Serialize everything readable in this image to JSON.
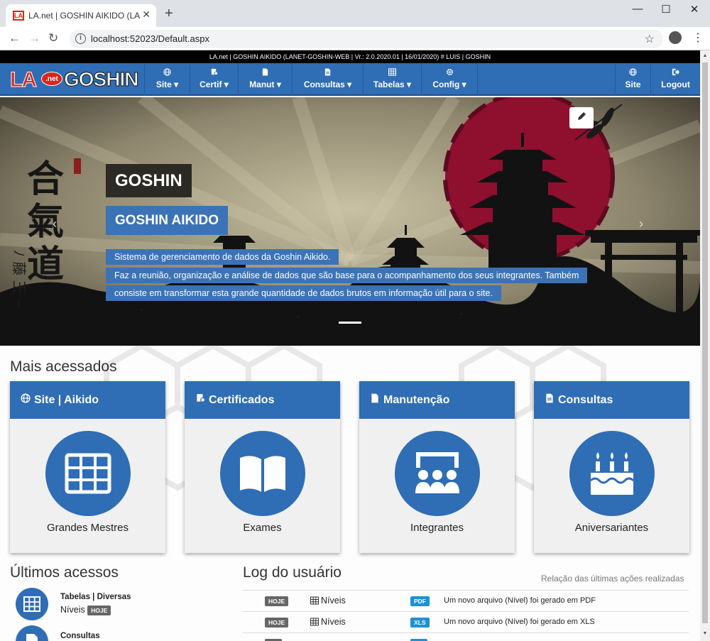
{
  "browser": {
    "tab_title": "LA.net | GOSHIN AIKIDO (LANET-",
    "favicon_text": "LA",
    "url": "localhost:52023/Default.aspx",
    "close_tab": "✕",
    "new_tab": "+",
    "minimize": "—",
    "maximize": "☐",
    "close": "✕",
    "back": "←",
    "forward": "→",
    "reload": "↻",
    "star": "☆",
    "menu": "⋮",
    "info": "i"
  },
  "info_bar": "LA.net | GOSHIN AIKIDO (LANET-GOSHIN-WEB | Vr.: 2.0.2020.01 | 16/01/2020) # LUIS | GOSHIN",
  "logo": {
    "la": "LA",
    "net": ".net",
    "goshin": "GOSHIN"
  },
  "nav": {
    "items": [
      {
        "label": "Site ▾",
        "icon": "globe-icon"
      },
      {
        "label": "Certif ▾",
        "icon": "certificate-icon"
      },
      {
        "label": "Manut ▾",
        "icon": "file-icon"
      },
      {
        "label": "Consultas ▾",
        "icon": "document-icon"
      },
      {
        "label": "Tabelas ▾",
        "icon": "table-icon"
      },
      {
        "label": "Config ▾",
        "icon": "gear-icon"
      }
    ],
    "right": [
      {
        "label": "Site",
        "icon": "globe-icon"
      },
      {
        "label": "Logout",
        "icon": "logout-icon"
      }
    ]
  },
  "hero": {
    "title": "GOSHIN",
    "subtitle": "GOSHIN AIKIDO",
    "lines": [
      "Sistema de gerenciamento de dados da Goshin Aikido.",
      "Faz a reunião, organização e análise de dados que são base para o acompanhamento dos seus integrantes. Também",
      "consiste em transformar esta grande quantidade de dados brutos em informação útil para o site."
    ],
    "calligraphy": "合氣道",
    "prev": "‹",
    "next": "›"
  },
  "most_accessed": {
    "title": "Mais acessados",
    "cards": [
      {
        "header": "Site | Aikido",
        "label": "Grandes Mestres",
        "icon": "globe-icon"
      },
      {
        "header": "Certificados",
        "label": "Exames",
        "icon": "certificate-icon"
      },
      {
        "header": "Manutenção",
        "label": "Integrantes",
        "icon": "file-icon"
      },
      {
        "header": "Consultas",
        "label": "Aniversariantes",
        "icon": "document-icon"
      }
    ]
  },
  "last_access": {
    "title": "Últimos acessos",
    "items": [
      {
        "title": "Tabelas | Diversas",
        "sub": "Níveis",
        "badge": "HOJE"
      },
      {
        "title": "Consultas"
      }
    ]
  },
  "log": {
    "title": "Log do usuário",
    "caption": "Relação das últimas ações realizadas",
    "rows": [
      {
        "when": "HOJE",
        "name": "Níveis",
        "type": "PDF",
        "msg": "Um novo arquivo (Nível) foi gerado em PDF"
      },
      {
        "when": "HOJE",
        "name": "Níveis",
        "type": "XLS",
        "msg": "Um novo arquivo (Nível) foi gerado em XLS"
      }
    ]
  },
  "colors": {
    "primary": "#2f6db5",
    "red": "#d9261c",
    "dark": "#2b2a25"
  }
}
